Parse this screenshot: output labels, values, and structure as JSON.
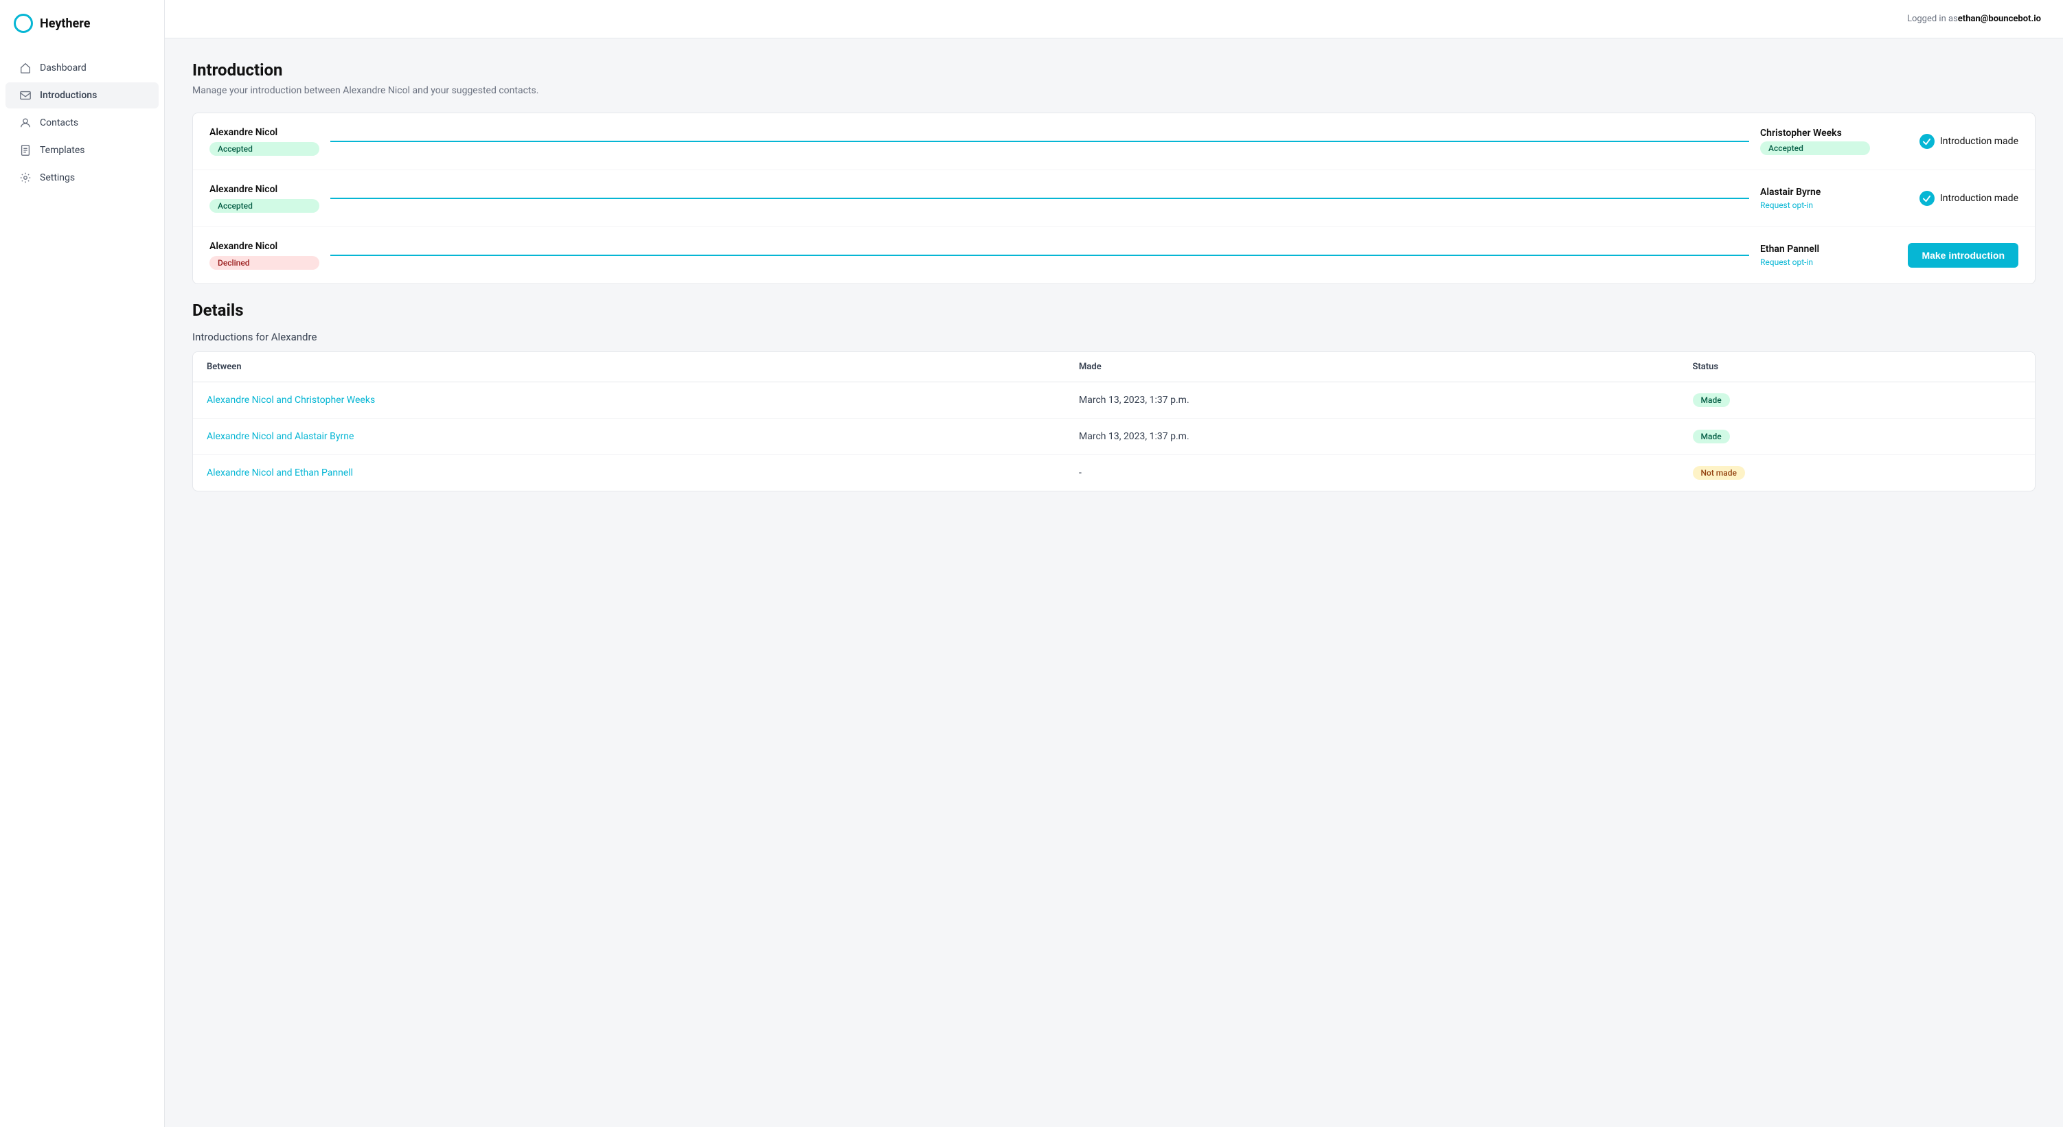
{
  "app": {
    "logo_text": "Heythere",
    "logged_in_label": "Logged in as ",
    "logged_in_user": "ethan@bouncebot.io"
  },
  "sidebar": {
    "items": [
      {
        "id": "dashboard",
        "label": "Dashboard",
        "icon": "home"
      },
      {
        "id": "introductions",
        "label": "Introductions",
        "icon": "mail",
        "active": true
      },
      {
        "id": "contacts",
        "label": "Contacts",
        "icon": "user"
      },
      {
        "id": "templates",
        "label": "Templates",
        "icon": "file"
      },
      {
        "id": "settings",
        "label": "Settings",
        "icon": "gear"
      }
    ]
  },
  "page": {
    "title": "Introduction",
    "subtitle": "Manage your introduction between Alexandre Nicol and your suggested contacts."
  },
  "introductions": [
    {
      "left_name": "Alexandre Nicol",
      "left_status": "Accepted",
      "left_badge_type": "accepted",
      "right_name": "Christopher Weeks",
      "right_status": "Accepted",
      "right_badge_type": "accepted",
      "right_sub": "",
      "action_type": "made",
      "action_label": "Introduction made"
    },
    {
      "left_name": "Alexandre Nicol",
      "left_status": "Accepted",
      "left_badge_type": "accepted",
      "right_name": "Alastair Byrne",
      "right_status": "",
      "right_badge_type": "",
      "right_sub": "Request opt-in",
      "action_type": "made",
      "action_label": "Introduction made"
    },
    {
      "left_name": "Alexandre Nicol",
      "left_status": "Declined",
      "left_badge_type": "declined",
      "right_name": "Ethan Pannell",
      "right_status": "",
      "right_badge_type": "",
      "right_sub": "Request opt-in",
      "action_type": "button",
      "action_label": "Make introduction"
    }
  ],
  "details": {
    "title": "Details",
    "subtitle": "Introductions for Alexandre",
    "table": {
      "columns": [
        "Between",
        "Made",
        "Status"
      ],
      "rows": [
        {
          "between": "Alexandre Nicol and Christopher Weeks",
          "made": "March 13, 2023, 1:37 p.m.",
          "status": "Made",
          "status_type": "made"
        },
        {
          "between": "Alexandre Nicol and Alastair Byrne",
          "made": "March 13, 2023, 1:37 p.m.",
          "status": "Made",
          "status_type": "made"
        },
        {
          "between": "Alexandre Nicol and Ethan Pannell",
          "made": "-",
          "status": "Not made",
          "status_type": "not-made"
        }
      ]
    }
  }
}
